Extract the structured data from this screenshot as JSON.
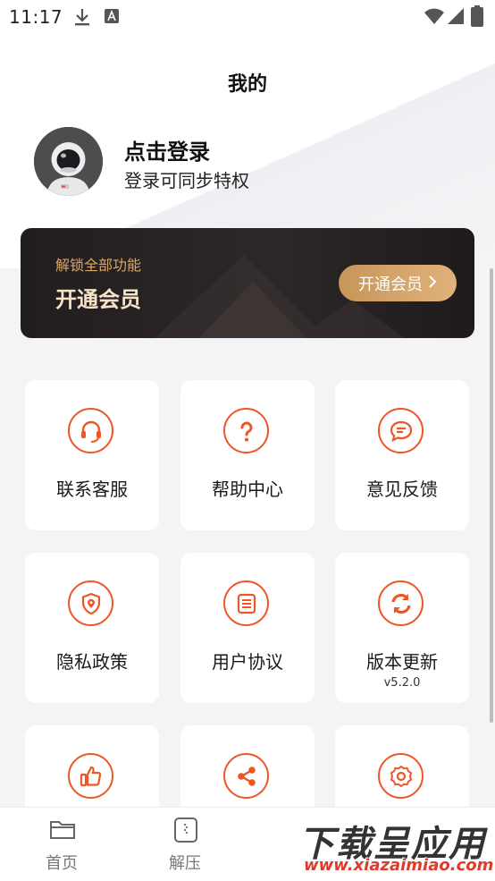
{
  "status_bar": {
    "time": "11:17",
    "icons": [
      "download-icon",
      "font-icon",
      "wifi-icon",
      "signal-icon",
      "battery-icon"
    ]
  },
  "header": {
    "title": "我的"
  },
  "profile": {
    "login_title": "点击登录",
    "login_subtitle": "登录可同步特权"
  },
  "vip": {
    "subtitle": "解锁全部功能",
    "title": "开通会员",
    "button_label": "开通会员"
  },
  "menu": [
    {
      "label": "联系客服",
      "icon": "headset-icon"
    },
    {
      "label": "帮助中心",
      "icon": "question-icon"
    },
    {
      "label": "意见反馈",
      "icon": "message-icon"
    },
    {
      "label": "隐私政策",
      "icon": "shield-icon"
    },
    {
      "label": "用户协议",
      "icon": "document-icon"
    },
    {
      "label": "版本更新",
      "version": "v5.2.0",
      "icon": "refresh-icon"
    },
    {
      "label": "",
      "icon": "thumbs-up-icon"
    },
    {
      "label": "",
      "icon": "share-icon"
    },
    {
      "label": "",
      "icon": "gear-icon"
    }
  ],
  "tabbar": [
    {
      "label": "首页",
      "icon": "folder-icon"
    },
    {
      "label": "解压",
      "icon": "archive-icon"
    }
  ],
  "watermark": {
    "line1": "下载呈应用",
    "line2": "www.xiazaimiao.com"
  },
  "colors": {
    "accent": "#ee5626",
    "gold": "#d9a86a",
    "vip_bg": "#231e1f"
  }
}
